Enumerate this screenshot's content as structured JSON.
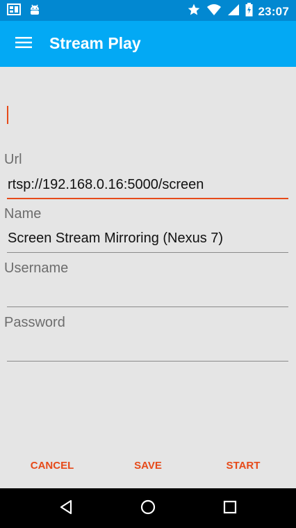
{
  "status_bar": {
    "time": "23:07",
    "icons": [
      "screen-cast-icon",
      "android-icon",
      "star-icon",
      "wifi-icon",
      "signal-icon",
      "battery-icon"
    ]
  },
  "app_bar": {
    "title": "Stream Play",
    "menu_icon": "hamburger-menu-icon"
  },
  "form": {
    "url": {
      "label": "Url",
      "value": "rtsp://192.168.0.16:5000/screen"
    },
    "name": {
      "label": "Name",
      "value": "Screen Stream Mirroring (Nexus 7)"
    },
    "username": {
      "label": "Username",
      "value": ""
    },
    "password": {
      "label": "Password",
      "value": ""
    }
  },
  "actions": {
    "cancel": "CANCEL",
    "save": "SAVE",
    "start": "START"
  },
  "nav_bar": {
    "icons": [
      "back-icon",
      "home-icon",
      "recents-icon"
    ]
  },
  "colors": {
    "status_bar": "#0288d1",
    "app_bar": "#03a9f4",
    "accent": "#e64a19",
    "background": "#e5e5e5"
  }
}
